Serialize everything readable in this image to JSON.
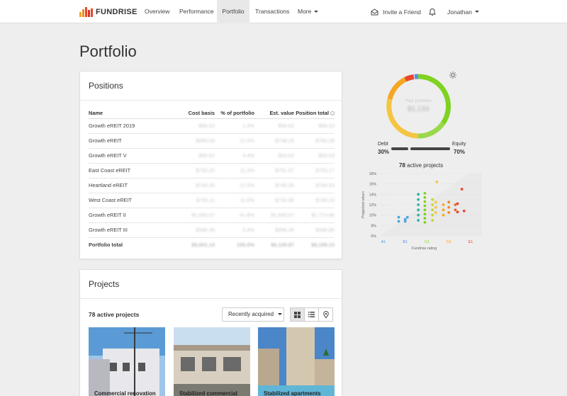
{
  "nav": {
    "brand": "FUNDRISE",
    "items": [
      "Overview",
      "Performance",
      "Portfolio",
      "Transactions",
      "More"
    ],
    "active": "Portfolio",
    "invite": "Invite a Friend",
    "user": "Jonathan",
    "logo_colors": [
      "#f5a623",
      "#f08a24",
      "#e8472b",
      "#d9322a",
      "#e8472b"
    ]
  },
  "page": {
    "title": "Portfolio"
  },
  "positions": {
    "heading": "Positions",
    "columns": [
      "Name",
      "Cost basis",
      "% of portfolio",
      "Est. value",
      "Position total"
    ],
    "rows": [
      [
        "Growth eREIT 2019",
        "$96.63",
        "1.3%",
        "$96.63",
        "$96.63"
      ],
      [
        "Growth eREIT",
        "$890.09",
        "12.0%",
        "$738.29",
        "$760.28"
      ],
      [
        "Growth eREIT V",
        "$90.62",
        "4.4%",
        "$93.63",
        "$93.63"
      ],
      [
        "East Coast eREIT",
        "$730.20",
        "11.3%",
        "$751.37",
        "$763.17"
      ],
      [
        "Heartland eREIT",
        "$735.35",
        "12.0%",
        "$745.35",
        "$784.53"
      ],
      [
        "West Coast eREIT",
        "$735.11",
        "11.0%",
        "$732.99",
        "$746.23"
      ],
      [
        "Growth eREIT II",
        "$1,690.57",
        "41.8%",
        "$1,690.57",
        "$1,714.96"
      ],
      [
        "Growth eREIT III",
        "$396.39",
        "5.4%",
        "$396.39",
        "$398.85"
      ]
    ],
    "total": [
      "Portfolio total",
      "$6,001.14",
      "100.0%",
      "$6,129.97",
      "$6,199.13"
    ]
  },
  "projects": {
    "heading": "Projects",
    "count_label": "78 active projects",
    "sort_label": "Recently acquired",
    "cards": [
      "Commercial renovation",
      "Stabilized commercial",
      "Stabilized apartments"
    ]
  },
  "summary": {
    "center_label": "Your portfolio",
    "center_value": "$6,199",
    "debt_label": "Debt",
    "debt_pct": "30%",
    "equity_label": "Equity",
    "equity_pct": "70%",
    "active_count": "78",
    "active_suffix": "active projects"
  },
  "chart_data": {
    "type": "scatter",
    "xlabel": "Fundrise rating",
    "ylabel": "Projected return",
    "x_ticks": [
      "A1",
      "B1",
      "C1",
      "D1",
      "E1"
    ],
    "x_tick_colors": [
      "#5b8def",
      "#5b8def",
      "#7ed321",
      "#f5a623",
      "#e8472b"
    ],
    "y_ticks": [
      "6%",
      "8%",
      "10%",
      "12%",
      "14%",
      "16%",
      "18%"
    ],
    "ylim": [
      6,
      18
    ],
    "points": [
      [
        1.7,
        9.6,
        "#4aa3df"
      ],
      [
        1.7,
        8.8,
        "#4aa3df"
      ],
      [
        2.0,
        9.2,
        "#4aa3df"
      ],
      [
        2.1,
        9.6,
        "#4aa3df"
      ],
      [
        2.0,
        8.8,
        "#4aa3df"
      ],
      [
        2.6,
        9.0,
        "#2bb5a0"
      ],
      [
        2.6,
        10.0,
        "#2bb5a0"
      ],
      [
        2.6,
        11.0,
        "#2bb5a0"
      ],
      [
        2.6,
        12.0,
        "#2bb5a0"
      ],
      [
        2.6,
        13.0,
        "#2bb5a0"
      ],
      [
        2.6,
        14.0,
        "#2bb5a0"
      ],
      [
        2.9,
        8.6,
        "#7ed321"
      ],
      [
        2.9,
        9.4,
        "#7ed321"
      ],
      [
        2.9,
        10.2,
        "#7ed321"
      ],
      [
        2.9,
        11.0,
        "#7ed321"
      ],
      [
        2.9,
        11.8,
        "#7ed321"
      ],
      [
        2.9,
        12.6,
        "#7ed321"
      ],
      [
        2.9,
        13.4,
        "#7ed321"
      ],
      [
        2.9,
        14.2,
        "#7ed321"
      ],
      [
        3.25,
        9.0,
        "#c8d62a"
      ],
      [
        3.25,
        10.0,
        "#c8d62a"
      ],
      [
        3.25,
        11.0,
        "#c8d62a"
      ],
      [
        3.25,
        12.0,
        "#c8d62a"
      ],
      [
        3.25,
        13.0,
        "#c8d62a"
      ],
      [
        3.4,
        10.5,
        "#f5c542"
      ],
      [
        3.4,
        11.5,
        "#f5c542"
      ],
      [
        3.4,
        12.5,
        "#f5c542"
      ],
      [
        3.45,
        16.4,
        "#f5c542"
      ],
      [
        3.75,
        10.0,
        "#f5a623"
      ],
      [
        3.75,
        11.0,
        "#f5a623"
      ],
      [
        3.75,
        12.0,
        "#f5a623"
      ],
      [
        4.0,
        10.5,
        "#f08a24"
      ],
      [
        4.0,
        11.5,
        "#f08a24"
      ],
      [
        4.0,
        12.5,
        "#f08a24"
      ],
      [
        4.3,
        11.0,
        "#e8672b"
      ],
      [
        4.3,
        12.0,
        "#e8672b"
      ],
      [
        4.4,
        10.6,
        "#e8472b"
      ],
      [
        4.4,
        12.2,
        "#e8472b"
      ],
      [
        4.7,
        10.8,
        "#e8472b"
      ],
      [
        4.6,
        15.0,
        "#e8472b"
      ]
    ]
  }
}
